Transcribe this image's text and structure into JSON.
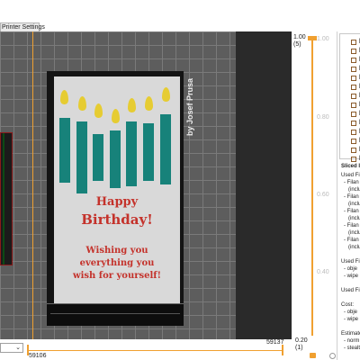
{
  "tabs": {
    "printer_settings": "Printer Settings"
  },
  "card": {
    "author": "by Josef Prusa",
    "line1": "Happy",
    "line2": "Birthday!",
    "line3": "Wishing you",
    "line4": "everything you",
    "line5": "wish for yourself!"
  },
  "hslider": {
    "right_value": "59137",
    "left_value": "59106"
  },
  "vslider": {
    "top_height": "1.00",
    "top_layer": "(5)",
    "bottom_height": "0.20",
    "bottom_layer": "(1)"
  },
  "right_panel": {
    "objects": [
      "b",
      "b",
      "b",
      "b",
      "b",
      "b",
      "b",
      "b",
      "b",
      "b",
      "b",
      "b",
      "b",
      "b"
    ],
    "sliced_info": {
      "title": "Sliced I",
      "lines": [
        "Used Fila",
        "- Filan",
        "(inclu",
        "- Filan",
        "(inclu",
        "- Filan",
        "(inclu",
        "- Filan",
        "(inclu",
        "- Filan",
        "(inclu",
        "",
        "Used Fila",
        "- obje",
        "- wipe",
        "",
        "Used Fila",
        "",
        "Cost:",
        "- obje",
        "- wipe",
        "",
        "Estimate",
        "- norm",
        "- stealt",
        "",
        "Number"
      ]
    }
  },
  "colors": {
    "accent": "#f0a030",
    "candle": "#17827a",
    "flame": "#e6cc32",
    "text_red": "#c4322b",
    "bed": "#5d5d5d"
  }
}
